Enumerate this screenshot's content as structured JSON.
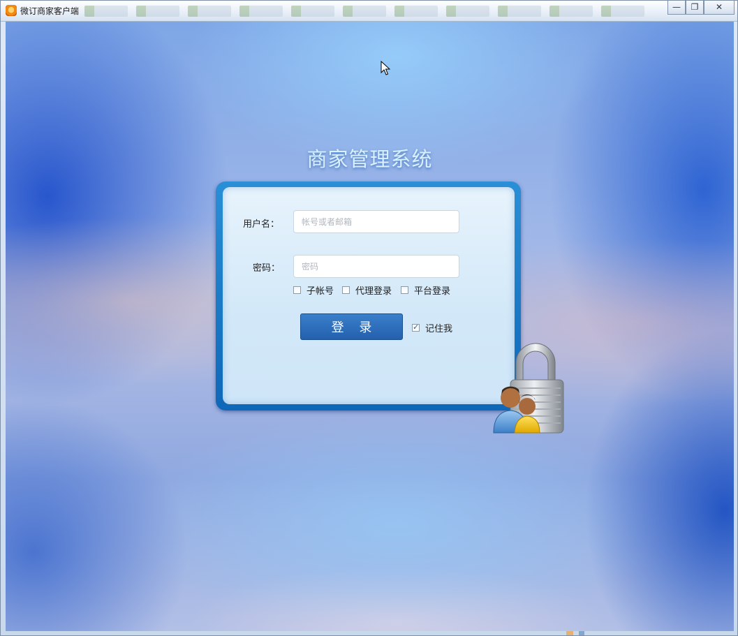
{
  "window": {
    "title": "微订商家客户端",
    "icon": "app-logo-icon",
    "controls": [
      "minimize-icon",
      "restore-icon",
      "close-icon"
    ]
  },
  "login": {
    "system_title": "商家管理系统",
    "username_label": "用户名：",
    "username_placeholder": "帐号或者邮箱",
    "username_value": "",
    "password_label": "密码：",
    "password_placeholder": "密码",
    "password_value": "",
    "options": [
      {
        "label": "子帐号",
        "checked": false
      },
      {
        "label": "代理登录",
        "checked": false
      },
      {
        "label": "平台登录",
        "checked": false
      }
    ],
    "login_button": "登 录",
    "remember_me": {
      "label": "记住我",
      "checked": true
    }
  },
  "colors": {
    "card_border": "#1e78c8",
    "button": "#2a6bb8",
    "title_text": "#d9f0ff"
  }
}
